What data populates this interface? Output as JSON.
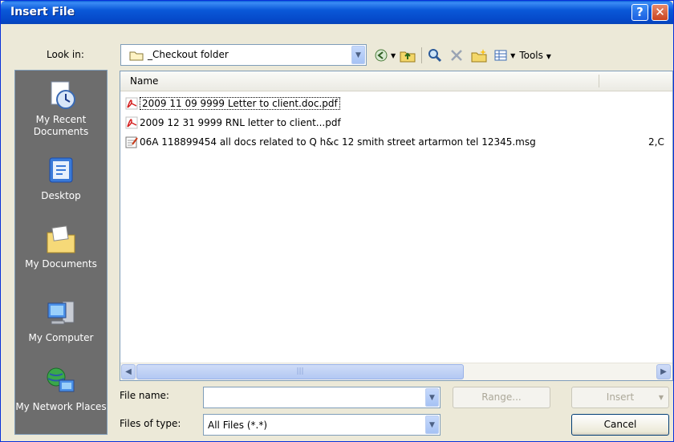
{
  "window": {
    "title": "Insert File",
    "help_glyph": "?",
    "close_glyph": "✕"
  },
  "lookin": {
    "label": "Look in:",
    "value": "_Checkout folder"
  },
  "toolbar": {
    "tools_label": "Tools"
  },
  "places": [
    {
      "label": "My Recent Documents"
    },
    {
      "label": "Desktop"
    },
    {
      "label": "My Documents"
    },
    {
      "label": "My Computer"
    },
    {
      "label": "My Network Places"
    }
  ],
  "list": {
    "column_name": "Name",
    "rows": [
      {
        "name": "2009 11 09 9999 Letter to client.doc.pdf",
        "icon": "pdf-icon",
        "extra": ""
      },
      {
        "name": "2009  12 31 9999 RNL letter to client...pdf",
        "icon": "pdf-icon",
        "extra": ""
      },
      {
        "name": "06A 118899454 all docs related to Q h&c 12 smith street artarmon tel 12345.msg",
        "icon": "msg-icon",
        "extra": "2,C"
      }
    ]
  },
  "filename": {
    "label": "File name:",
    "value": ""
  },
  "filetype": {
    "label": "Files of type:",
    "value": "All Files (*.*)"
  },
  "buttons": {
    "range": "Range...",
    "insert": "Insert",
    "cancel": "Cancel"
  },
  "colors": {
    "title_bar": "#0a58d8",
    "places_bar": "#6d6d6d",
    "face": "#ece9d8"
  }
}
